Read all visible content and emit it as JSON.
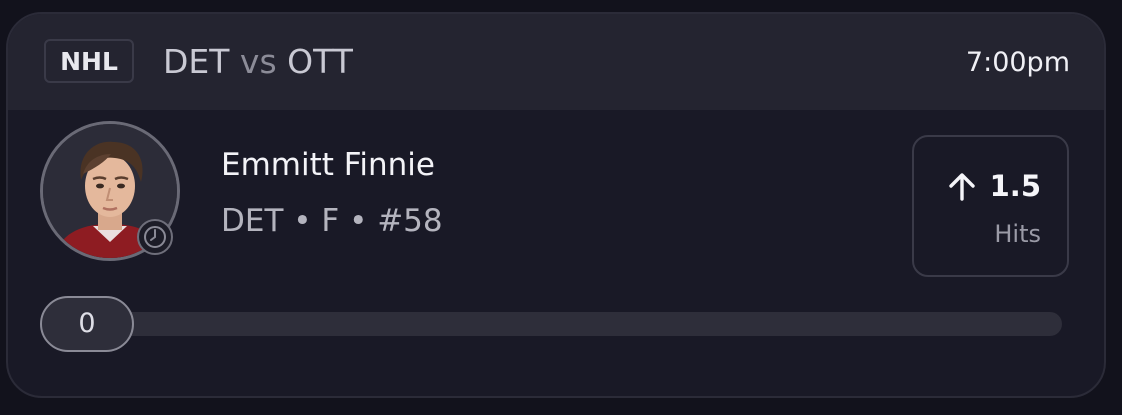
{
  "game": {
    "league": "NHL",
    "home_team": "DET",
    "vs_label": "vs",
    "away_team": "OTT",
    "time": "7:00pm"
  },
  "player": {
    "name": "Emmitt Finnie",
    "meta": "DET • F • #58",
    "avatar_icon": "player-headshot",
    "status_icon": "clock-icon"
  },
  "prop": {
    "direction_icon": "arrow-up-icon",
    "value": "1.5",
    "stat": "Hits"
  },
  "progress": {
    "current": "0",
    "fraction": 0
  },
  "colors": {
    "background": "#12121c",
    "card": "#191926",
    "header": "#242430",
    "text_primary": "#f3f3f7",
    "text_secondary": "#b4b4be"
  }
}
